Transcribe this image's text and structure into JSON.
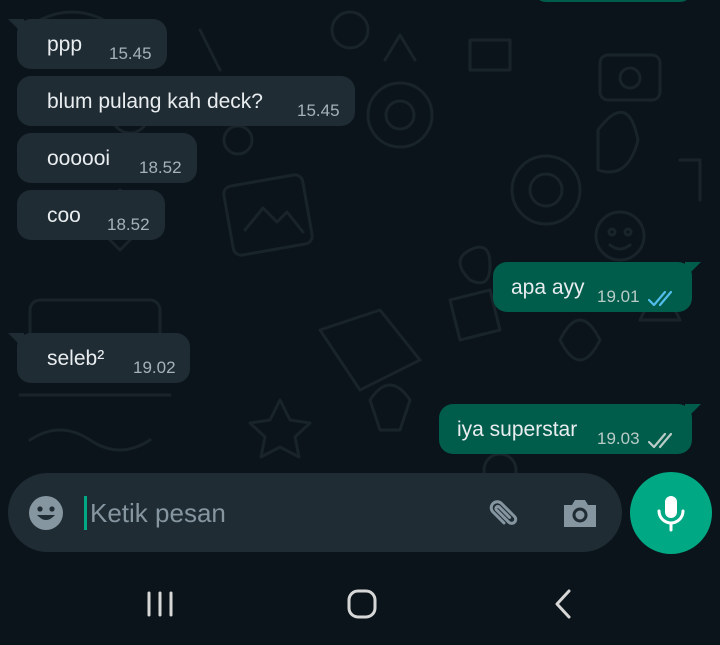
{
  "messages": [
    {
      "dir": "in",
      "text": "ppp",
      "time": "15.45"
    },
    {
      "dir": "in",
      "text": "blum pulang kah deck?",
      "time": "15.45"
    },
    {
      "dir": "in",
      "text": "oooooi",
      "time": "18.52"
    },
    {
      "dir": "in",
      "text": "coo",
      "time": "18.52"
    },
    {
      "dir": "out",
      "text": "apa ayy",
      "time": "19.01",
      "status": "read"
    },
    {
      "dir": "in",
      "text": "seleb²",
      "time": "19.02"
    },
    {
      "dir": "out",
      "text": "iya superstar",
      "time": "19.03",
      "status": "delivered"
    }
  ],
  "composer": {
    "placeholder": "Ketik pesan",
    "emoji_icon": "emoji-icon",
    "attach_icon": "paperclip-icon",
    "camera_icon": "camera-icon",
    "mic_icon": "microphone-icon"
  },
  "nav": {
    "recents_icon": "recents-icon",
    "home_icon": "home-icon",
    "back_icon": "back-icon"
  },
  "colors": {
    "background": "#0b141a",
    "incoming_bubble": "#1f2c34",
    "outgoing_bubble": "#005c4b",
    "accent": "#00a884",
    "read_ticks": "#53bdeb",
    "delivered_ticks": "#b9ccc7"
  }
}
